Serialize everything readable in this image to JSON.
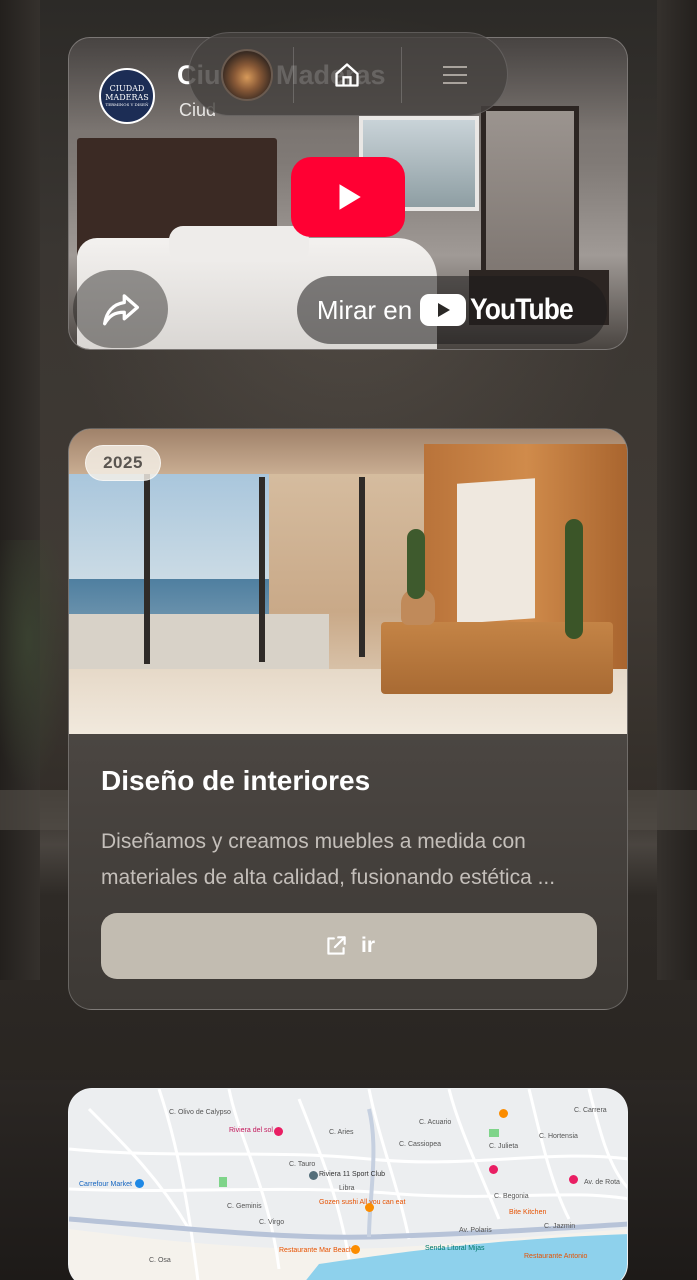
{
  "video": {
    "channel_logo_text": [
      "CIUDAD",
      "MADERAS"
    ],
    "channel_logo_tagline": "TERMINOS Y DISEÑ",
    "channel_title": "Ciudad Maderas",
    "channel_subtitle": "Ciud",
    "watch_on_label": "Mirar en",
    "youtube_word": "YouTube",
    "icons": {
      "play": "play-icon",
      "share": "share-arrow-icon",
      "youtube": "youtube-logo-icon"
    },
    "colors": {
      "play_red": "#ff0033"
    }
  },
  "nav": {
    "icons": {
      "avatar": "avatar",
      "home": "home-icon",
      "menu": "hamburger-menu-icon"
    }
  },
  "project": {
    "year": "2025",
    "title": "Diseño de interiores",
    "description": "Diseñamos y creamos muebles a medida con materiales de alta calidad, fusionando estética ...",
    "button_label": "ir",
    "button_icon": "external-link-icon",
    "colors": {
      "button_bg": "#c2bcb1"
    }
  },
  "map": {
    "labels": {
      "riviera": "Riviera del sol",
      "carrefour": "Carrefour Market",
      "sport_club": "Riviera 11 Sport Club",
      "sushi": "Gozen sushi All you can eat",
      "bite": "Bite Kitchen",
      "restaurant1": "Restaurante Mar Beach",
      "senda": "Senda Litoral Mijas",
      "restaurant2": "Restaurante Antonio",
      "polaris": "Av. Polaris",
      "jazmin": "C. Jazmin",
      "libra": "Libra",
      "aries": "C. Aries",
      "acuario": "C. Acuario",
      "cassiopea": "C. Cassiopea",
      "geminis": "C. Geminis",
      "tauro": "C. Tauro",
      "virgo": "C. Virgo",
      "osa": "C. Osa",
      "begonia": "C. Begonia",
      "julieta": "C. Julieta",
      "hortensia": "C. Hortensia",
      "carrera": "C. Carrera",
      "olivo": "C. Olivo de Calypso",
      "rota": "Av. de Rota"
    }
  }
}
